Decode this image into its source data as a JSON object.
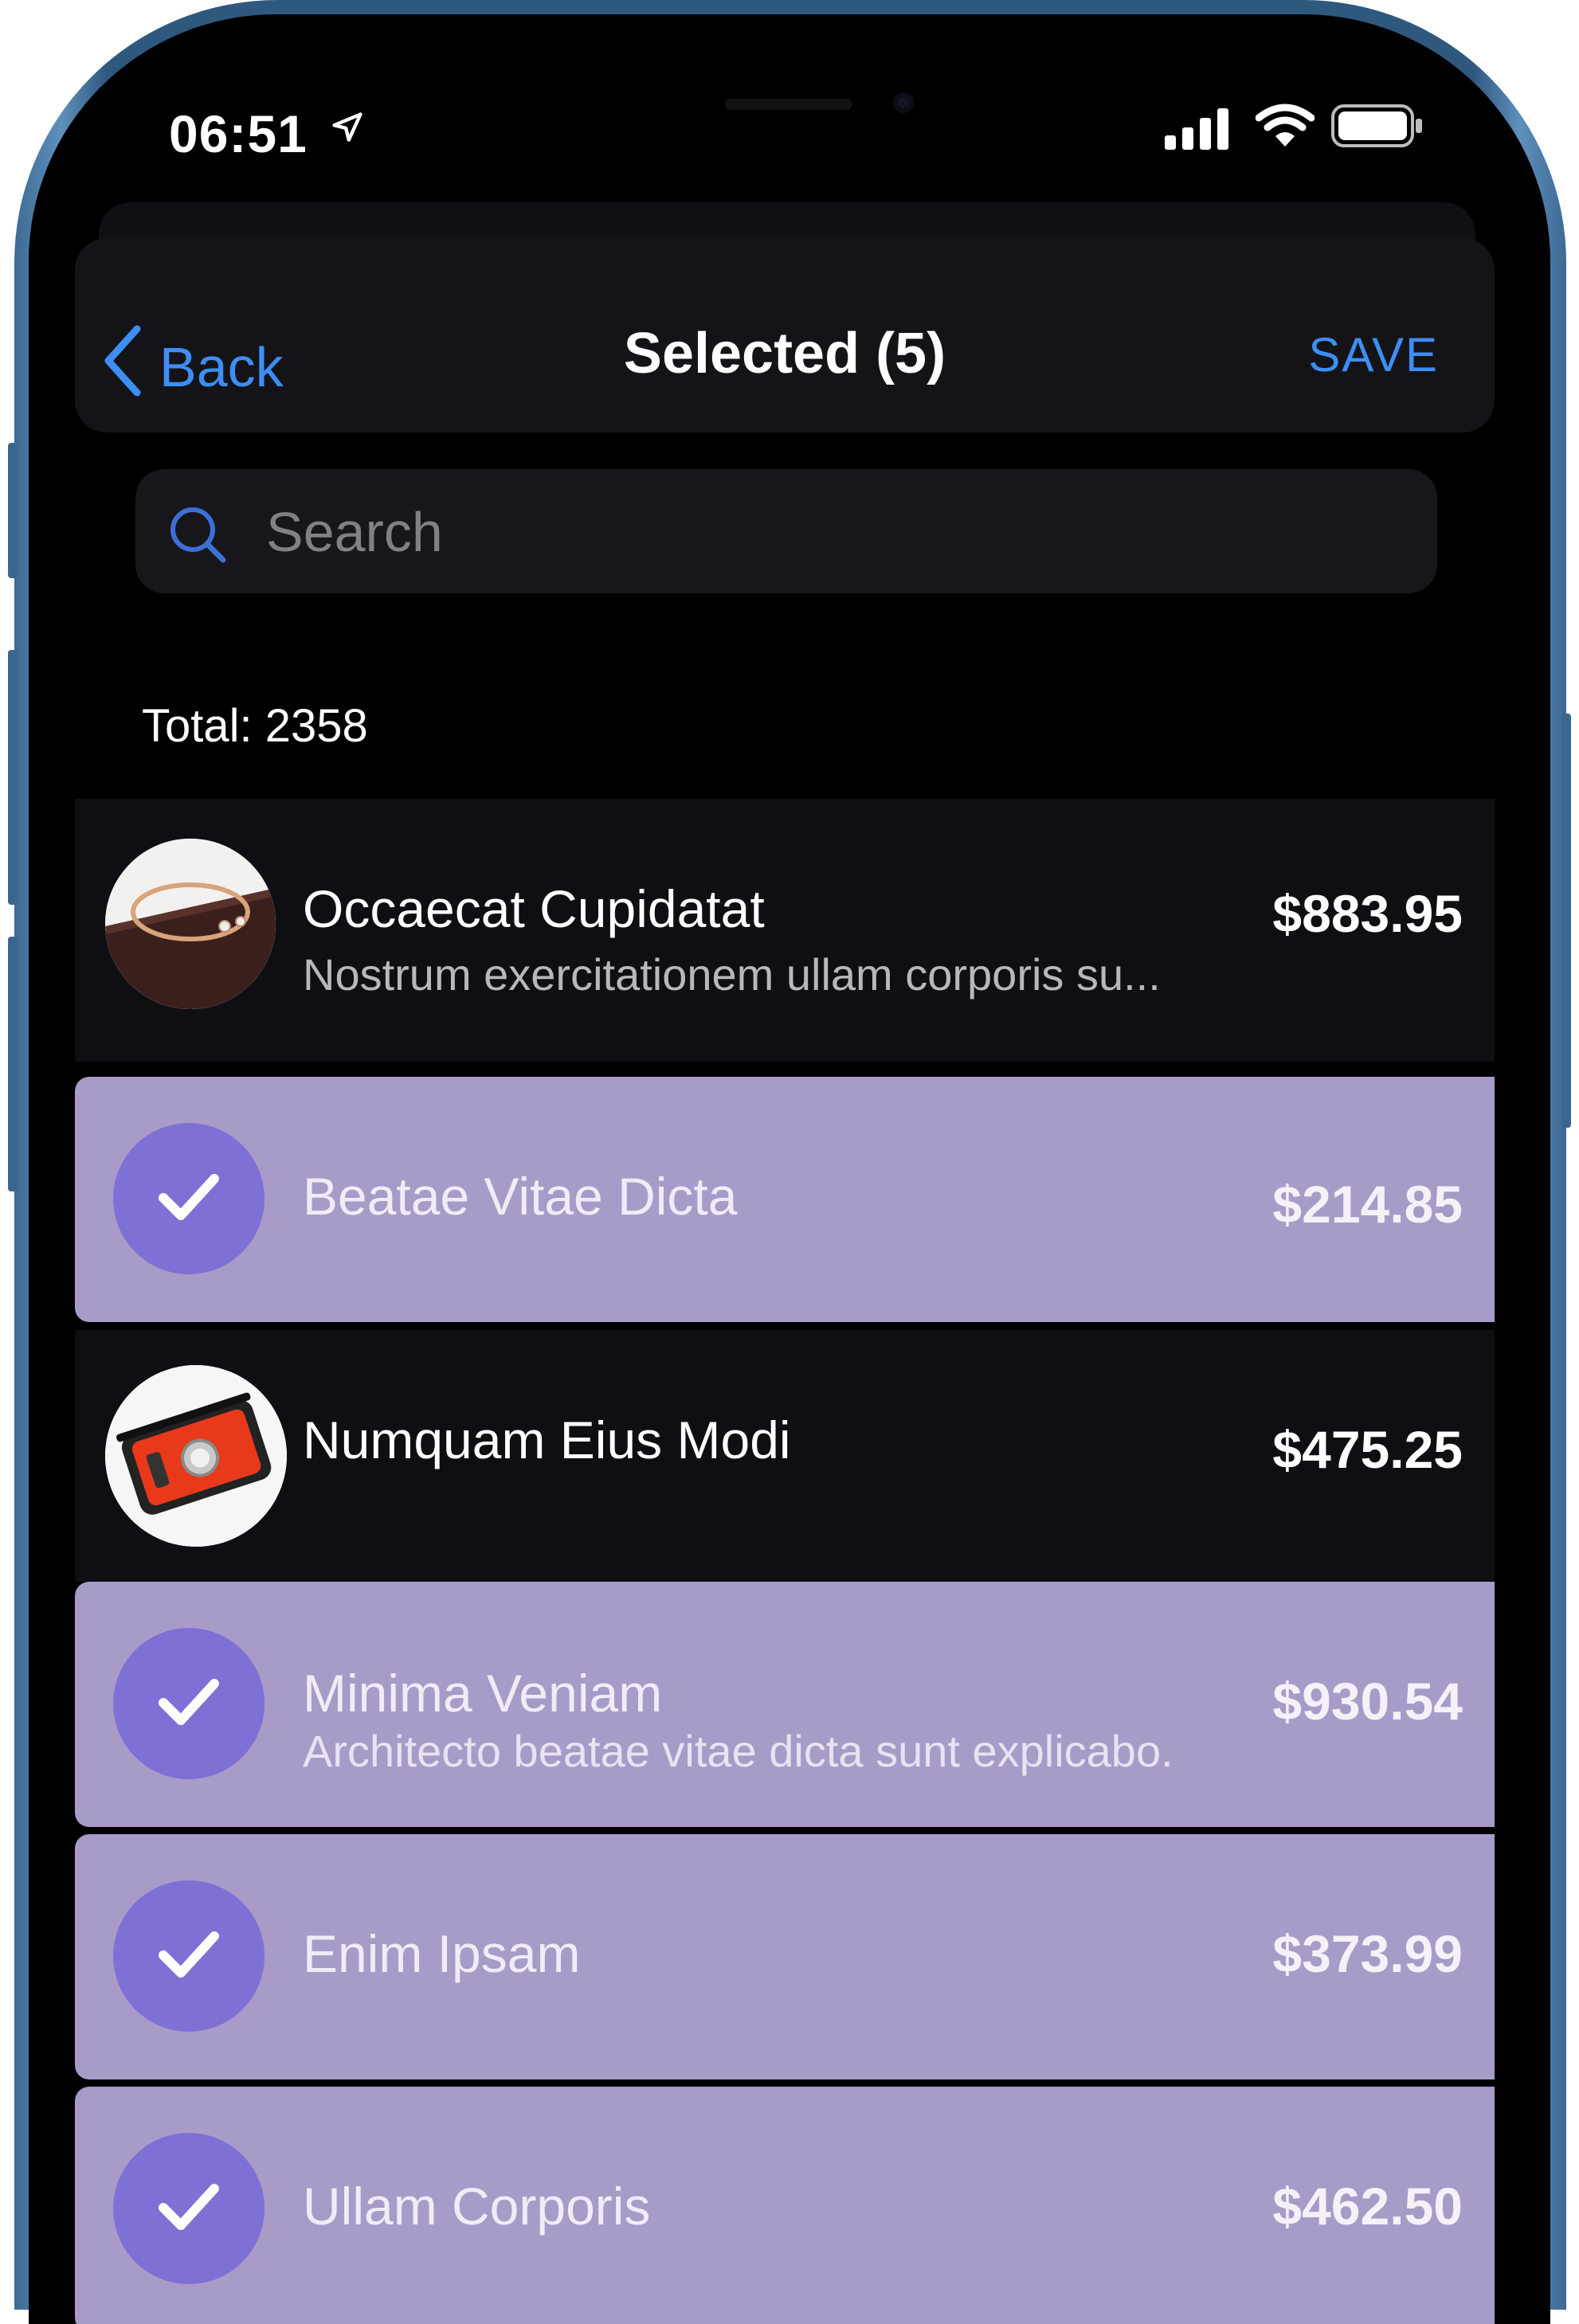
{
  "status_bar": {
    "time": "06:51"
  },
  "nav": {
    "back_label": "Back",
    "title": "Selected (5)",
    "save_label": "SAVE"
  },
  "search": {
    "placeholder": "Search"
  },
  "total_label": "Total: 2358",
  "items": [
    {
      "name": "Occaecat Cupidatat",
      "subtitle": "Nostrum exercitationem ullam corporis su...",
      "price": "$883.95",
      "selected": false
    },
    {
      "name": "Beatae Vitae Dicta",
      "subtitle": "",
      "price": "$214.85",
      "selected": true
    },
    {
      "name": "Numquam Eius Modi",
      "subtitle": "",
      "price": "$475.25",
      "selected": false
    },
    {
      "name": "Minima Veniam",
      "subtitle": "Architecto beatae vitae dicta sunt explicabo.",
      "price": "$930.54",
      "selected": true
    },
    {
      "name": "Enim Ipsam",
      "subtitle": "",
      "price": "$373.99",
      "selected": true
    },
    {
      "name": "Ullam Corporis",
      "subtitle": "",
      "price": "$462.50",
      "selected": true
    }
  ],
  "colors": {
    "accent": "#3d8ef5",
    "selected_row": "#a89bc8",
    "check_circle": "#7f70d6",
    "background": "#000000"
  },
  "icons": [
    "location-arrow-icon",
    "signal-icon",
    "wifi-icon",
    "battery-icon",
    "chevron-left-icon",
    "search-icon",
    "checkmark-icon"
  ]
}
